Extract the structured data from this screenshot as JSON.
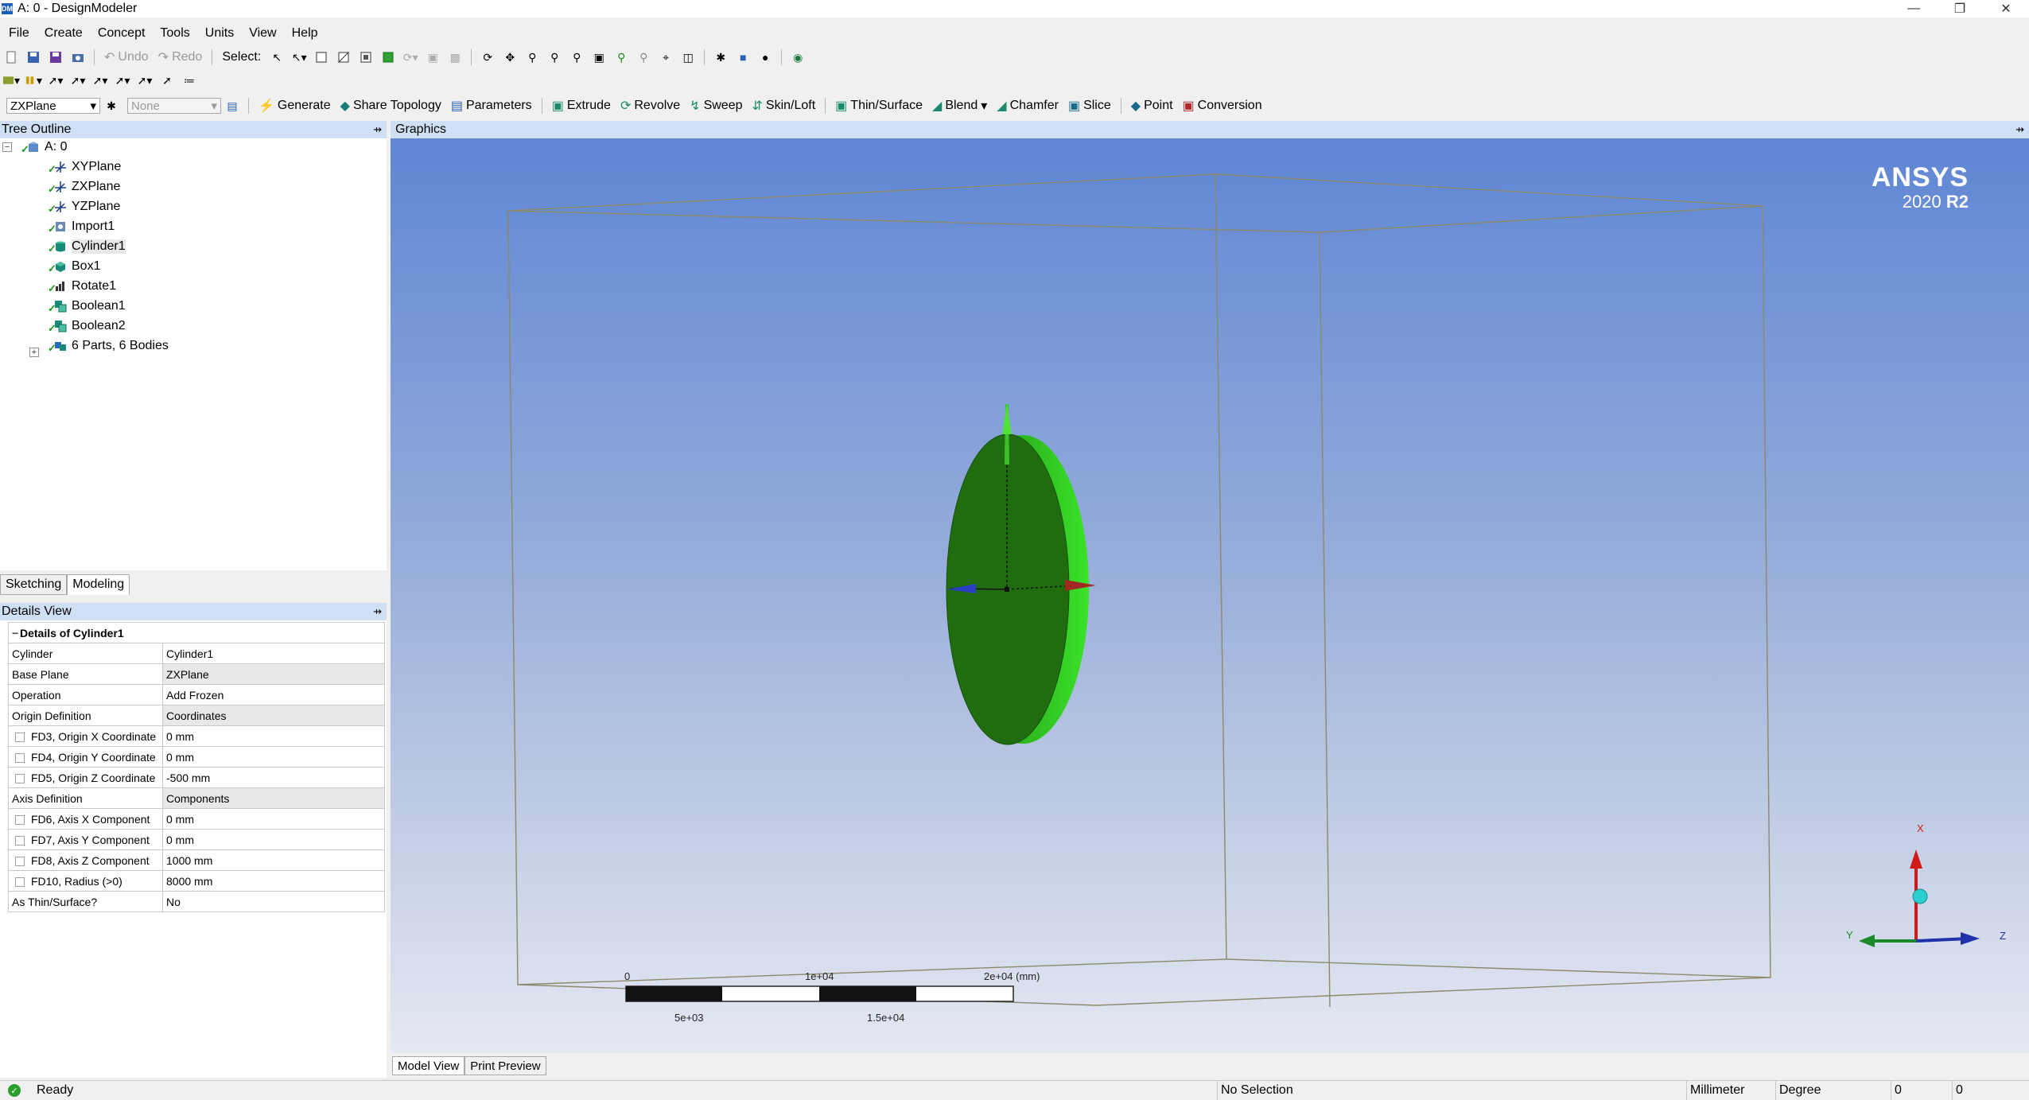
{
  "window": {
    "title": "A: 0 - DesignModeler",
    "app_icon_text": "DM",
    "minimize": "—",
    "maximize": "❐",
    "close": "✕"
  },
  "menu": [
    "File",
    "Create",
    "Concept",
    "Tools",
    "Units",
    "View",
    "Help"
  ],
  "toolbar1": {
    "undo": "Undo",
    "redo": "Redo",
    "select_label": "Select:"
  },
  "toolbar3": {
    "plane_combo": "ZXPlane",
    "sketch_combo": "None",
    "generate": "Generate",
    "share_topology": "Share Topology",
    "parameters": "Parameters",
    "extrude": "Extrude",
    "revolve": "Revolve",
    "sweep": "Sweep",
    "skin_loft": "Skin/Loft",
    "thin_surface": "Thin/Surface",
    "blend": "Blend",
    "chamfer": "Chamfer",
    "slice": "Slice",
    "point": "Point",
    "conversion": "Conversion"
  },
  "tree": {
    "header": "Tree Outline",
    "pin": "ũ",
    "root": "A: 0",
    "items": [
      {
        "label": "XYPlane",
        "icon": "plane-icon"
      },
      {
        "label": "ZXPlane",
        "icon": "plane-icon"
      },
      {
        "label": "YZPlane",
        "icon": "plane-icon"
      },
      {
        "label": "Import1",
        "icon": "import-icon"
      },
      {
        "label": "Cylinder1",
        "icon": "cylinder-icon"
      },
      {
        "label": "Box1",
        "icon": "box-icon"
      },
      {
        "label": "Rotate1",
        "icon": "rotate-icon"
      },
      {
        "label": "Boolean1",
        "icon": "boolean-icon"
      },
      {
        "label": "Boolean2",
        "icon": "boolean-icon"
      },
      {
        "label": "6 Parts, 6 Bodies",
        "icon": "parts-icon"
      }
    ]
  },
  "left_tabs": [
    "Sketching",
    "Modeling"
  ],
  "details": {
    "header": "Details View",
    "title": "Details of Cylinder1",
    "rows": [
      {
        "name": "Cylinder",
        "value": "Cylinder1",
        "checkbox": false
      },
      {
        "name": "Base Plane",
        "value": "ZXPlane",
        "checkbox": false
      },
      {
        "name": "Operation",
        "value": "Add Frozen",
        "checkbox": false
      },
      {
        "name": "Origin Definition",
        "value": "Coordinates",
        "checkbox": false
      },
      {
        "name": "FD3, Origin X Coordinate",
        "value": "0 mm",
        "checkbox": true
      },
      {
        "name": "FD4, Origin Y Coordinate",
        "value": "0 mm",
        "checkbox": true
      },
      {
        "name": "FD5, Origin Z Coordinate",
        "value": "-500 mm",
        "checkbox": true
      },
      {
        "name": "Axis Definition",
        "value": "Components",
        "checkbox": false
      },
      {
        "name": "FD6, Axis X Component",
        "value": "0 mm",
        "checkbox": true
      },
      {
        "name": "FD7, Axis Y Component",
        "value": "0 mm",
        "checkbox": true
      },
      {
        "name": "FD8, Axis Z Component",
        "value": "1000 mm",
        "checkbox": true
      },
      {
        "name": "FD10, Radius (>0)",
        "value": "8000 mm",
        "checkbox": true
      },
      {
        "name": "As Thin/Surface?",
        "value": "No",
        "checkbox": false
      }
    ]
  },
  "graphics": {
    "header": "Graphics",
    "logo_brand": "ANSYS",
    "logo_version": "2020",
    "logo_release": "R2",
    "scale_top_labels": [
      "0",
      "1e+04",
      "2e+04 (mm)"
    ],
    "scale_bottom_labels": [
      "5e+03",
      "1.5e+04"
    ],
    "triad": {
      "x": "X",
      "y": "Y",
      "z": "Z"
    }
  },
  "graphics_tabs": [
    "Model View",
    "Print Preview"
  ],
  "status": {
    "ready": "Ready",
    "selection": "No Selection",
    "length_unit": "Millimeter",
    "angle_unit": "Degree",
    "field1": "0",
    "field2": "0"
  },
  "colors": {
    "panel_header": "#cfe0f4",
    "cylinder_face": "#1f6d0f",
    "cylinder_rim": "#35d620"
  }
}
